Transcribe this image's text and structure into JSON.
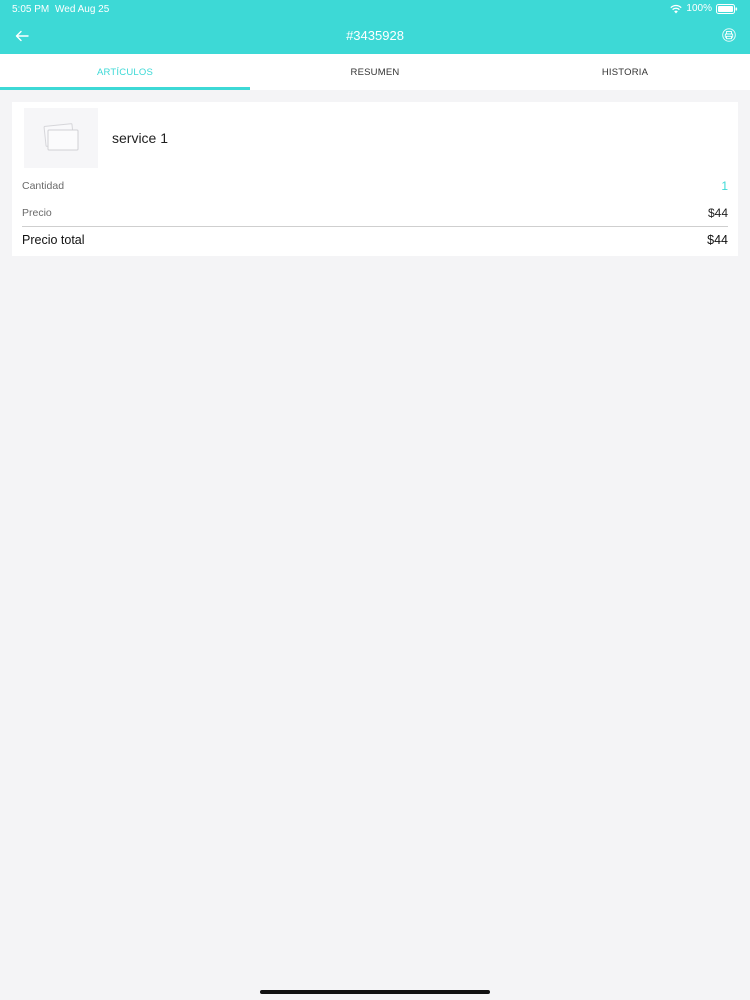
{
  "status_bar": {
    "time": "5:05 PM",
    "date": "Wed Aug 25",
    "battery": "100%"
  },
  "nav": {
    "title": "#3435928",
    "back_icon": "arrow-left-icon",
    "print_icon": "printer-icon"
  },
  "tabs": [
    {
      "label": "ARTÍCULOS",
      "active": true
    },
    {
      "label": "RESUMEN",
      "active": false
    },
    {
      "label": "HISTORIA",
      "active": false
    }
  ],
  "item": {
    "name": "service 1",
    "thumbnail_icon": "image-placeholder-icon",
    "quantity_label": "Cantidad",
    "quantity_value": "1",
    "price_label": "Precio",
    "price_value": "$44",
    "total_label": "Precio total",
    "total_value": "$44"
  },
  "colors": {
    "accent": "#3dd9d6",
    "background": "#f4f4f6",
    "card": "#ffffff"
  }
}
